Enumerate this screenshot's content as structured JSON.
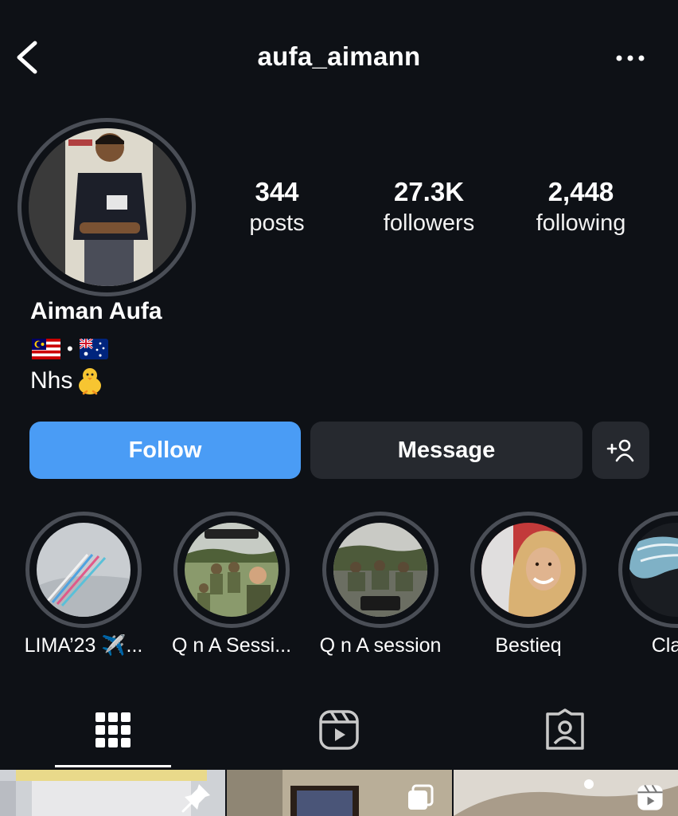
{
  "header": {
    "title": "aufa_aimann",
    "back_icon": "chevron-left-icon",
    "more_icon": "more-horizontal-icon"
  },
  "stats": {
    "posts_count": "344",
    "posts_label": "posts",
    "followers_count": "27.3K",
    "followers_label": "followers",
    "following_count": "2,448",
    "following_label": "following"
  },
  "profile": {
    "name": "Aiman Aufa",
    "flag_separator": "•",
    "bio": "Nhs",
    "bio_emoji": "baby-chick-icon"
  },
  "actions": {
    "follow_label": "Follow",
    "message_label": "Message",
    "add_user_icon": "add-user-icon"
  },
  "highlights": [
    {
      "label": "LIMA’23 ✈️..."
    },
    {
      "label": "Q n A Sessi..."
    },
    {
      "label": "Q n A session"
    },
    {
      "label": "Bestieq"
    },
    {
      "label": "Class"
    }
  ],
  "tabs": [
    {
      "icon": "grid-icon",
      "active": true
    },
    {
      "icon": "reels-icon",
      "active": false
    },
    {
      "icon": "tagged-icon",
      "active": false
    }
  ],
  "colors": {
    "background": "#0e1116",
    "follow_button": "#4a9cf5",
    "secondary_button": "#26292f",
    "ring": "#4a4e56"
  }
}
